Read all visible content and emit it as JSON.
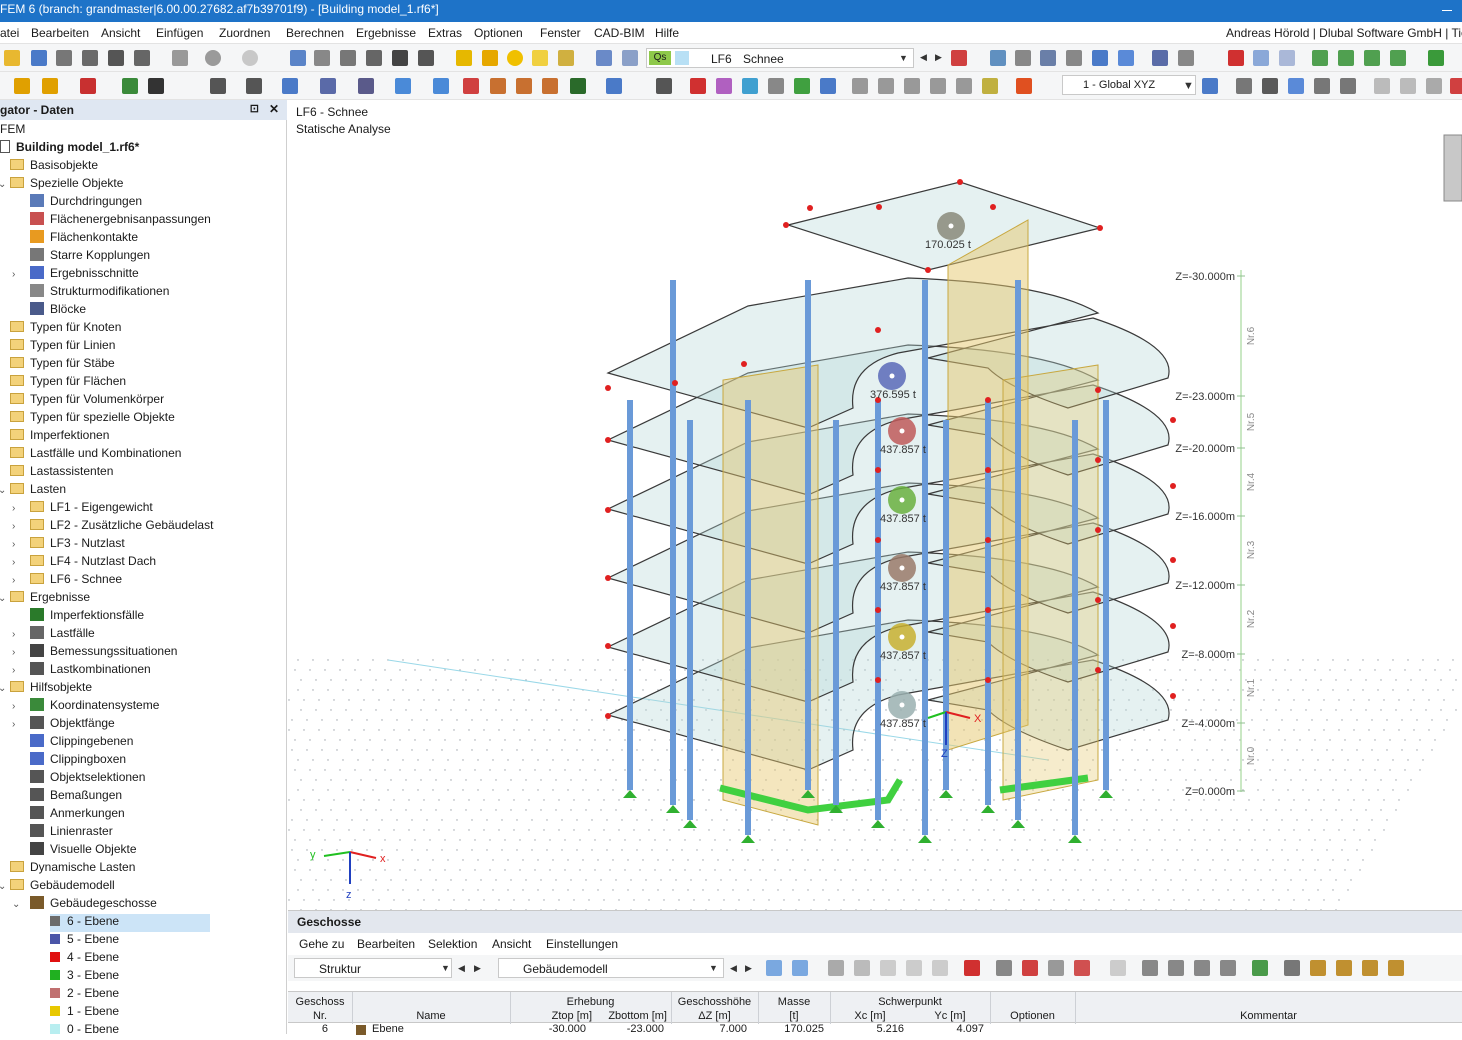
{
  "window": {
    "title": "FEM 6 (branch: grandmaster|6.00.00.27682.af7b39701f9) - [Building model_1.rf6*]"
  },
  "menu": {
    "items": [
      "atei",
      "Bearbeiten",
      "Ansicht",
      "Einfügen",
      "Zuordnen",
      "Berechnen",
      "Ergebnisse",
      "Extras",
      "Optionen",
      "Fenster",
      "CAD-BIM",
      "Hilfe"
    ],
    "user": "Andreas Hörold | Dlubal Software GmbH | Tief"
  },
  "toolbar": {
    "load_case_badge": "Qs",
    "load_case_code": "LF6",
    "load_case_name": "Schnee",
    "coord_system": "1 - Global XYZ"
  },
  "navigator": {
    "title": "gator - Daten",
    "items": [
      {
        "label": "FEM"
      },
      {
        "label": "Building model_1.rf6*"
      },
      {
        "label": "Basisobjekte"
      },
      {
        "label": "Spezielle Objekte"
      },
      {
        "label": "Durchdringungen"
      },
      {
        "label": "Flächenergebnisanpassungen"
      },
      {
        "label": "Flächenkontakte"
      },
      {
        "label": "Starre Kopplungen"
      },
      {
        "label": "Ergebnisschnitte"
      },
      {
        "label": "Strukturmodifikationen"
      },
      {
        "label": "Blöcke"
      },
      {
        "label": "Typen für Knoten"
      },
      {
        "label": "Typen für Linien"
      },
      {
        "label": "Typen für Stäbe"
      },
      {
        "label": "Typen für Flächen"
      },
      {
        "label": "Typen für Volumenkörper"
      },
      {
        "label": "Typen für spezielle Objekte"
      },
      {
        "label": "Imperfektionen"
      },
      {
        "label": "Lastfälle und Kombinationen"
      },
      {
        "label": "Lastassistenten"
      },
      {
        "label": "Lasten"
      },
      {
        "label": "LF1 - Eigengewicht"
      },
      {
        "label": "LF2 - Zusätzliche Gebäudelast"
      },
      {
        "label": "LF3 - Nutzlast"
      },
      {
        "label": "LF4 - Nutzlast Dach"
      },
      {
        "label": "LF6 - Schnee"
      },
      {
        "label": "Ergebnisse"
      },
      {
        "label": "Imperfektionsfälle"
      },
      {
        "label": "Lastfälle"
      },
      {
        "label": "Bemessungssituationen"
      },
      {
        "label": "Lastkombinationen"
      },
      {
        "label": "Hilfsobjekte"
      },
      {
        "label": "Koordinatensysteme"
      },
      {
        "label": "Objektfänge"
      },
      {
        "label": "Clippingebenen"
      },
      {
        "label": "Clippingboxen"
      },
      {
        "label": "Objektselektionen"
      },
      {
        "label": "Bemaßungen"
      },
      {
        "label": "Anmerkungen"
      },
      {
        "label": "Linienraster"
      },
      {
        "label": "Visuelle Objekte"
      },
      {
        "label": "Dynamische Lasten"
      },
      {
        "label": "Gebäudemodell"
      },
      {
        "label": "Gebäudegeschosse"
      },
      {
        "label": "6 - Ebene",
        "color": "#6b6b6b"
      },
      {
        "label": "5 - Ebene",
        "color": "#4a55a8"
      },
      {
        "label": "4 - Ebene",
        "color": "#e01010"
      },
      {
        "label": "3 - Ebene",
        "color": "#20b020"
      },
      {
        "label": "2 - Ebene",
        "color": "#c07070"
      },
      {
        "label": "1 - Ebene",
        "color": "#e8c800"
      },
      {
        "label": "0 - Ebene",
        "color": "#b8eef0"
      }
    ]
  },
  "viewport": {
    "title": "LF6 - Schnee",
    "subtitle": "Statische Analyse",
    "masses": [
      "170.025 t",
      "376.595 t",
      "437.857 t",
      "437.857 t",
      "437.857 t",
      "437.857 t",
      "437.857 t"
    ],
    "levels": [
      "Z=-30.000m",
      "Z=-23.000m",
      "Z=-20.000m",
      "Z=-16.000m",
      "Z=-12.000m",
      "Z=-8.000m",
      "Z=-4.000m",
      "Z=0.000m"
    ],
    "storeys": [
      "Nr.6",
      "Nr.5",
      "Nr.4",
      "Nr.3",
      "Nr.2",
      "Nr.1",
      "Nr.0"
    ],
    "axes": {
      "x": "X",
      "y": "Y",
      "z": "Z",
      "x_small": "x",
      "y_small": "y",
      "z_small": "z"
    }
  },
  "panel": {
    "title": "Geschosse",
    "menu": [
      "Gehe zu",
      "Bearbeiten",
      "Selektion",
      "Ansicht",
      "Einstellungen"
    ],
    "dropdown_left": "Struktur",
    "dropdown_right": "Gebäudemodell",
    "headers": {
      "geschoss": "Geschoss",
      "nr": "Nr.",
      "name": "Name",
      "erhebung": "Erhebung",
      "ztop": "Ztop [m]",
      "zbottom": "Zbottom [m]",
      "hoehe": "Geschosshöhe",
      "dz": "ΔZ [m]",
      "masse": "Masse",
      "masse_unit": "[t]",
      "schwerpunkt": "Schwerpunkt",
      "xc": "Xc [m]",
      "yc": "Yc [m]",
      "optionen": "Optionen",
      "kommentar": "Kommentar"
    },
    "rows": [
      {
        "nr": "6",
        "name": "Ebene",
        "ztop": "-30.000",
        "zbottom": "-23.000",
        "dz": "7.000",
        "masse": "170.025",
        "xc": "5.216",
        "yc": "4.097"
      }
    ]
  }
}
